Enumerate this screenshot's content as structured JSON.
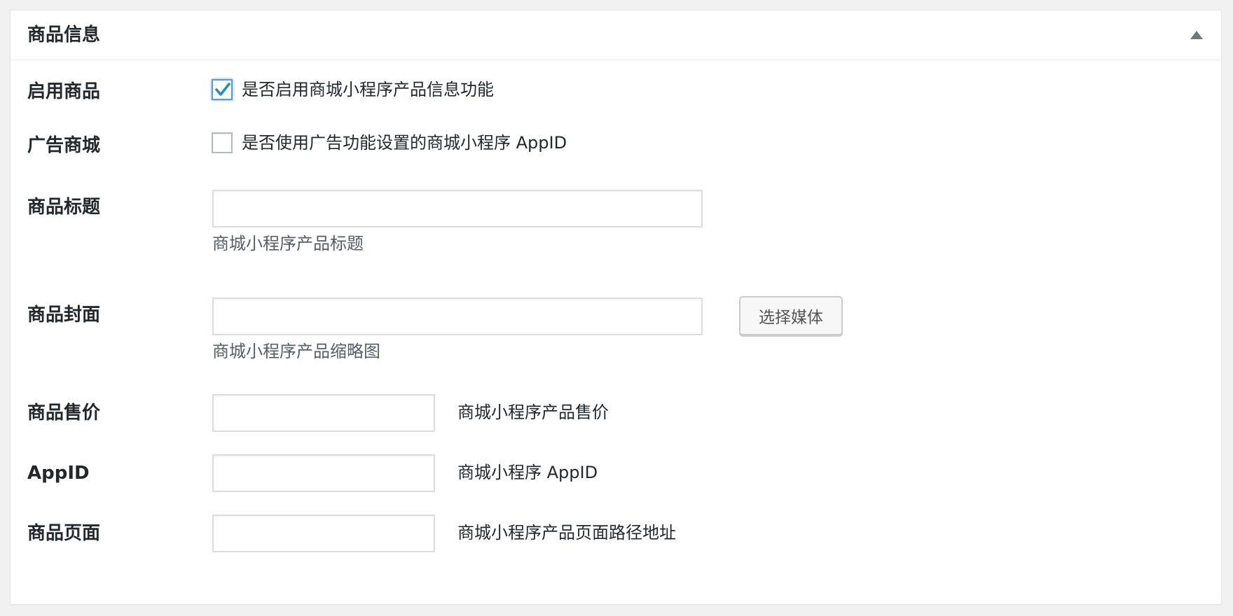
{
  "metabox": {
    "title": "商品信息",
    "toggle_icon": "triangle-up-icon"
  },
  "fields": {
    "enable": {
      "label": "启用商品",
      "checkbox_label": "是否启用商城小程序产品信息功能",
      "checked": true
    },
    "ad_mall": {
      "label": "广告商城",
      "checkbox_label": "是否使用广告功能设置的商城小程序 AppID",
      "checked": false
    },
    "title": {
      "label": "商品标题",
      "value": "",
      "description": "商城小程序产品标题"
    },
    "cover": {
      "label": "商品封面",
      "value": "",
      "button_label": "选择媒体",
      "description": "商城小程序产品缩略图"
    },
    "price": {
      "label": "商品售价",
      "value": "",
      "description": "商城小程序产品售价"
    },
    "appid": {
      "label": "AppID",
      "value": "",
      "description": "商城小程序 AppID"
    },
    "page": {
      "label": "商品页面",
      "value": "",
      "description": "商城小程序产品页面路径地址"
    }
  },
  "colors": {
    "checkmark": "#1e8cbe",
    "focus_border": "#5b9dd9",
    "text": "#23282d",
    "muted_text": "#555d66"
  }
}
